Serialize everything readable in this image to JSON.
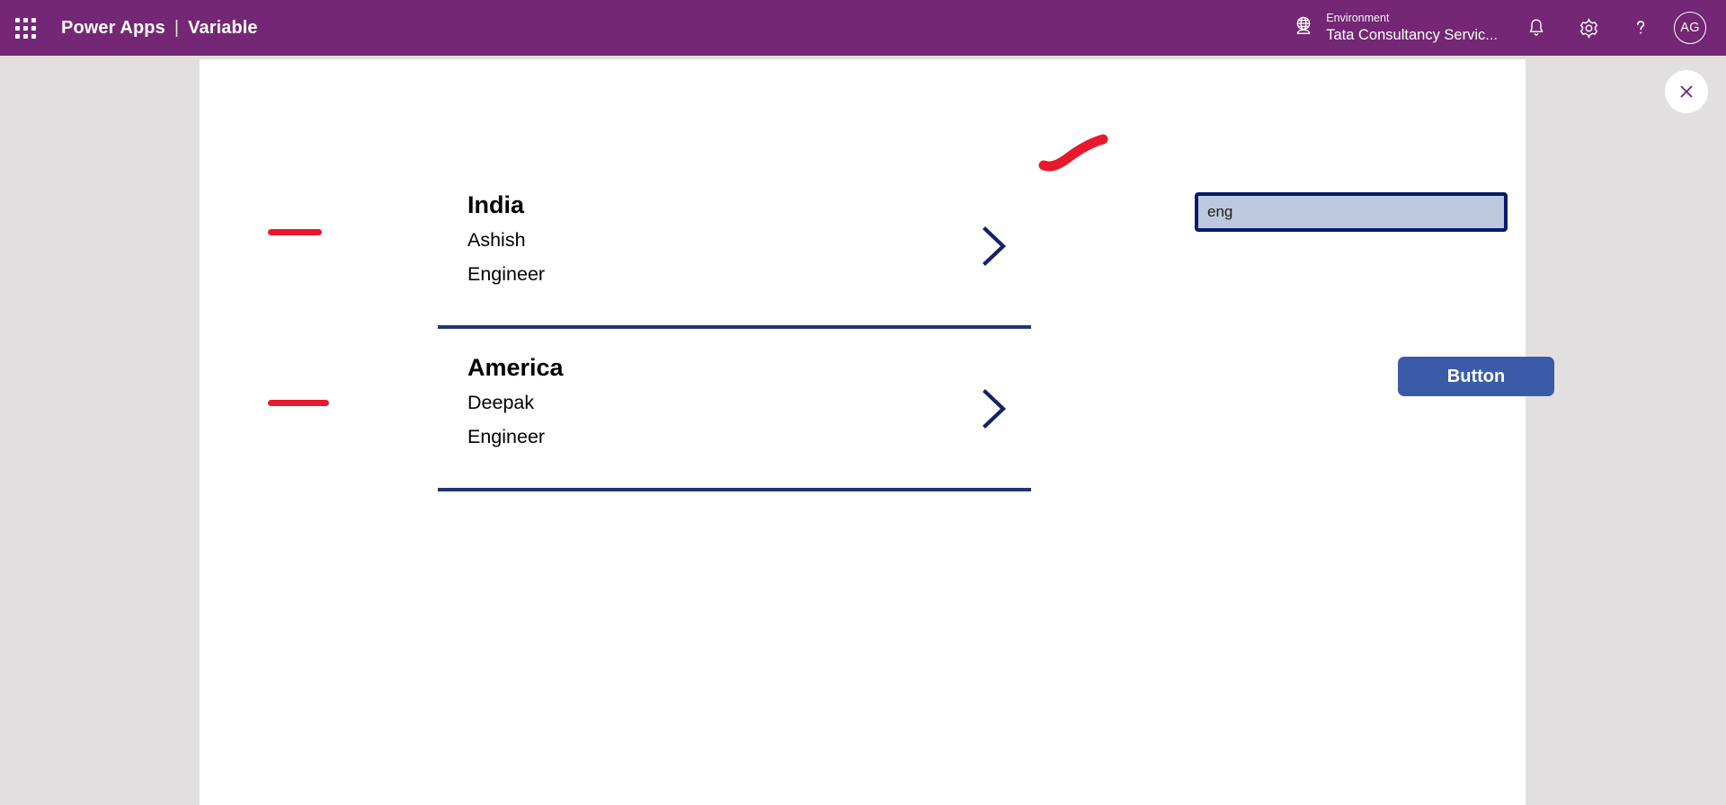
{
  "header": {
    "waffle_icon": "app-launcher-waffle-icon",
    "product": "Power Apps",
    "divider": "|",
    "app_name": "Variable",
    "environment": {
      "icon": "globe-environment-icon",
      "label": "Environment",
      "name": "Tata Consultancy Servic..."
    },
    "icons": [
      {
        "name": "notifications-bell-icon"
      },
      {
        "name": "settings-gear-icon"
      },
      {
        "name": "help-question-icon"
      }
    ],
    "avatar_initials": "AG",
    "background_color": "#742774"
  },
  "canvas": {
    "close_label": "close-icon",
    "background_color": "#ffffff"
  },
  "gallery": {
    "separator_color": "#243470",
    "chevron_color": "#16216b",
    "items": [
      {
        "title": "India",
        "name": "Ashish",
        "role": "Engineer",
        "chevron": "chevron-right-icon"
      },
      {
        "title": "America",
        "name": "Deepak",
        "role": "Engineer",
        "chevron": "chevron-right-icon"
      }
    ]
  },
  "text_input": {
    "value": "eng",
    "placeholder": "",
    "border_color": "#0a1a6b",
    "fill_color": "#bdc8de"
  },
  "button": {
    "label": "Button",
    "color": "#3a5ca8"
  },
  "annotations": {
    "ink_color": "#e8192c",
    "marks": [
      {
        "name": "underline-engineer-1"
      },
      {
        "name": "underline-engineer-2"
      },
      {
        "name": "swoosh-text-input"
      }
    ]
  }
}
